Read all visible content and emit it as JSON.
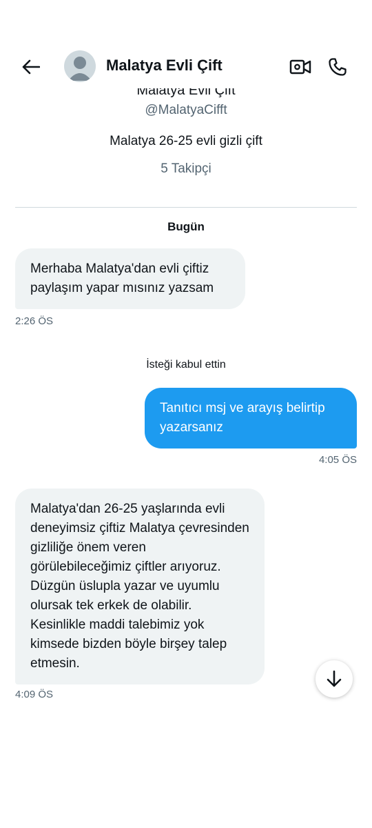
{
  "header": {
    "title": "Malatya Evli Çift",
    "back_icon": "arrow-left-icon",
    "video_icon": "video-call-icon",
    "call_icon": "phone-icon"
  },
  "profile": {
    "name": "Malatya Evli Çift",
    "handle": "@MalatyaCifft",
    "bio": "Malatya 26-25 evli gizli çift",
    "followers": "5 Takipçi"
  },
  "conversation": {
    "date_separator": "Bugün",
    "system_message": "İsteği kabul ettin",
    "messages": [
      {
        "direction": "incoming",
        "text": "Merhaba Malatya'dan evli çiftiz paylaşım yapar mısınız yazsam",
        "time": "2:26 ÖS"
      },
      {
        "direction": "outgoing",
        "text": "Tanıtıcı msj ve arayış belirtip yazarsanız",
        "time": "4:05 ÖS"
      },
      {
        "direction": "incoming",
        "text": "Malatya'dan 26-25 yaşlarında evli deneyimsiz çiftiz Malatya çevresinden gizliliğe önem veren görülebileceğimiz çiftler arıyoruz. Düzgün üslupla yazar ve uyumlu olursak tek erkek de olabilir. Kesinlikle maddi talebimiz yok kimsede bizden böyle birşey talep etmesin.",
        "time": "4:09 ÖS"
      }
    ]
  },
  "scroll_button": {
    "icon": "arrow-down-icon"
  },
  "colors": {
    "accent": "#1d9bf0",
    "incoming_bubble": "#eff3f4",
    "secondary_text": "#536471"
  }
}
